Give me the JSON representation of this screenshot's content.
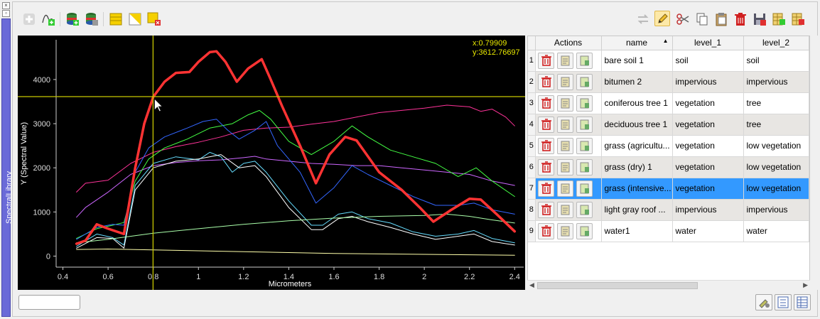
{
  "dock": {
    "title": "SpectralLibrary",
    "close_glyph": "×",
    "float_glyph": "▫"
  },
  "toolbar": {
    "left_tools": [
      "add-profile",
      "add-current-profile",
      "import-library",
      "export-library",
      "select-all",
      "invert-selection",
      "deselect"
    ],
    "right_tools": [
      "undo-redo",
      "toggle-editing",
      "cut",
      "copy",
      "paste",
      "delete-selected",
      "save-edits",
      "new-field",
      "delete-field"
    ],
    "editing_active": true
  },
  "plot": {
    "crosshair_x_label": "x:0.79909",
    "crosshair_y_label": "y:3612.76697",
    "crosshair": {
      "x": 0.79909,
      "y": 3612.76697
    },
    "xlabel": "Micrometers",
    "ylabel": "Y (Spectral Value)",
    "x_ticks": [
      "0.4",
      "0.6",
      "0.8",
      "1",
      "1.2",
      "1.4",
      "1.6",
      "1.8",
      "2",
      "2.2",
      "2.4"
    ],
    "y_ticks": [
      "0",
      "1000",
      "2000",
      "3000",
      "4000"
    ]
  },
  "chart_data": {
    "type": "line",
    "xlabel": "Micrometers",
    "ylabel": "Y (Spectral Value)",
    "xlim": [
      0.37,
      2.44
    ],
    "ylim": [
      -250,
      4900
    ],
    "grid": false,
    "series": [
      {
        "color": "#ff3333",
        "width": 3.5,
        "values": [
          [
            0.46,
            280
          ],
          [
            0.5,
            350
          ],
          [
            0.55,
            720
          ],
          [
            0.6,
            620
          ],
          [
            0.67,
            500
          ],
          [
            0.72,
            2000
          ],
          [
            0.76,
            3000
          ],
          [
            0.8,
            3610
          ],
          [
            0.85,
            3950
          ],
          [
            0.9,
            4150
          ],
          [
            0.96,
            4170
          ],
          [
            1.0,
            4400
          ],
          [
            1.05,
            4620
          ],
          [
            1.08,
            4640
          ],
          [
            1.12,
            4400
          ],
          [
            1.17,
            3950
          ],
          [
            1.22,
            4250
          ],
          [
            1.28,
            4460
          ],
          [
            1.32,
            4000
          ],
          [
            1.37,
            3400
          ],
          [
            1.45,
            2500
          ],
          [
            1.52,
            1650
          ],
          [
            1.58,
            2300
          ],
          [
            1.65,
            2700
          ],
          [
            1.7,
            2620
          ],
          [
            1.8,
            1900
          ],
          [
            1.9,
            1500
          ],
          [
            1.98,
            1100
          ],
          [
            2.04,
            780
          ],
          [
            2.12,
            1050
          ],
          [
            2.2,
            1300
          ],
          [
            2.25,
            1280
          ],
          [
            2.32,
            950
          ],
          [
            2.4,
            560
          ]
        ]
      },
      {
        "color": "#ff3399",
        "width": 1,
        "values": [
          [
            0.46,
            1450
          ],
          [
            0.5,
            1650
          ],
          [
            0.6,
            1720
          ],
          [
            0.7,
            2100
          ],
          [
            0.8,
            2350
          ],
          [
            0.9,
            2480
          ],
          [
            1.0,
            2580
          ],
          [
            1.1,
            2700
          ],
          [
            1.2,
            2850
          ],
          [
            1.3,
            2900
          ],
          [
            1.4,
            2920
          ],
          [
            1.5,
            2990
          ],
          [
            1.6,
            3050
          ],
          [
            1.7,
            3150
          ],
          [
            1.8,
            3250
          ],
          [
            1.9,
            3300
          ],
          [
            2.0,
            3350
          ],
          [
            2.1,
            3420
          ],
          [
            2.2,
            3380
          ],
          [
            2.25,
            3280
          ],
          [
            2.3,
            3330
          ],
          [
            2.36,
            3150
          ],
          [
            2.4,
            2950
          ]
        ]
      },
      {
        "color": "#cc66ff",
        "width": 1,
        "values": [
          [
            0.46,
            880
          ],
          [
            0.5,
            1100
          ],
          [
            0.6,
            1450
          ],
          [
            0.7,
            1850
          ],
          [
            0.8,
            2050
          ],
          [
            0.9,
            2120
          ],
          [
            1.0,
            2160
          ],
          [
            1.1,
            2180
          ],
          [
            1.2,
            2230
          ],
          [
            1.25,
            2260
          ],
          [
            1.3,
            2200
          ],
          [
            1.4,
            2150
          ],
          [
            1.5,
            2100
          ],
          [
            1.6,
            2080
          ],
          [
            1.7,
            2050
          ],
          [
            1.8,
            2050
          ],
          [
            1.9,
            2000
          ],
          [
            2.0,
            1950
          ],
          [
            2.1,
            1900
          ],
          [
            2.2,
            1850
          ],
          [
            2.3,
            1700
          ],
          [
            2.4,
            1600
          ]
        ]
      },
      {
        "color": "#44ff44",
        "width": 1,
        "values": [
          [
            0.46,
            400
          ],
          [
            0.55,
            620
          ],
          [
            0.62,
            700
          ],
          [
            0.67,
            760
          ],
          [
            0.72,
            1700
          ],
          [
            0.78,
            2200
          ],
          [
            0.85,
            2450
          ],
          [
            0.95,
            2650
          ],
          [
            1.05,
            2900
          ],
          [
            1.15,
            3000
          ],
          [
            1.22,
            3200
          ],
          [
            1.27,
            3300
          ],
          [
            1.32,
            3100
          ],
          [
            1.4,
            2600
          ],
          [
            1.5,
            2300
          ],
          [
            1.6,
            2600
          ],
          [
            1.68,
            2950
          ],
          [
            1.75,
            2700
          ],
          [
            1.85,
            2400
          ],
          [
            1.95,
            2250
          ],
          [
            2.05,
            2100
          ],
          [
            2.15,
            1800
          ],
          [
            2.23,
            2000
          ],
          [
            2.3,
            1700
          ],
          [
            2.4,
            1350
          ]
        ]
      },
      {
        "color": "#3366ff",
        "width": 1,
        "values": [
          [
            0.46,
            380
          ],
          [
            0.55,
            650
          ],
          [
            0.62,
            720
          ],
          [
            0.67,
            700
          ],
          [
            0.72,
            1900
          ],
          [
            0.78,
            2450
          ],
          [
            0.85,
            2700
          ],
          [
            0.95,
            2900
          ],
          [
            1.02,
            3050
          ],
          [
            1.08,
            3100
          ],
          [
            1.13,
            2850
          ],
          [
            1.18,
            2650
          ],
          [
            1.25,
            2850
          ],
          [
            1.3,
            3050
          ],
          [
            1.35,
            2500
          ],
          [
            1.45,
            1900
          ],
          [
            1.52,
            1200
          ],
          [
            1.6,
            1550
          ],
          [
            1.68,
            2050
          ],
          [
            1.75,
            1850
          ],
          [
            1.85,
            1600
          ],
          [
            1.95,
            1350
          ],
          [
            2.05,
            1150
          ],
          [
            2.15,
            1150
          ],
          [
            2.22,
            1200
          ],
          [
            2.3,
            1050
          ],
          [
            2.4,
            950
          ]
        ]
      },
      {
        "color": "#66ddff",
        "width": 1,
        "values": [
          [
            0.46,
            220
          ],
          [
            0.55,
            500
          ],
          [
            0.62,
            420
          ],
          [
            0.67,
            250
          ],
          [
            0.72,
            1600
          ],
          [
            0.8,
            2100
          ],
          [
            0.9,
            2250
          ],
          [
            1.0,
            2180
          ],
          [
            1.05,
            2350
          ],
          [
            1.1,
            2250
          ],
          [
            1.15,
            1900
          ],
          [
            1.2,
            2100
          ],
          [
            1.25,
            2150
          ],
          [
            1.3,
            1900
          ],
          [
            1.4,
            1250
          ],
          [
            1.5,
            700
          ],
          [
            1.55,
            700
          ],
          [
            1.62,
            950
          ],
          [
            1.68,
            1000
          ],
          [
            1.75,
            850
          ],
          [
            1.85,
            750
          ],
          [
            1.95,
            550
          ],
          [
            2.05,
            450
          ],
          [
            2.15,
            500
          ],
          [
            2.22,
            580
          ],
          [
            2.3,
            400
          ],
          [
            2.4,
            300
          ]
        ]
      },
      {
        "color": "#ffffff",
        "width": 1,
        "values": [
          [
            0.46,
            180
          ],
          [
            0.55,
            420
          ],
          [
            0.62,
            400
          ],
          [
            0.67,
            180
          ],
          [
            0.72,
            1500
          ],
          [
            0.8,
            2000
          ],
          [
            0.9,
            2150
          ],
          [
            1.0,
            2200
          ],
          [
            1.1,
            2300
          ],
          [
            1.18,
            2000
          ],
          [
            1.25,
            2050
          ],
          [
            1.3,
            1800
          ],
          [
            1.4,
            1100
          ],
          [
            1.5,
            600
          ],
          [
            1.55,
            600
          ],
          [
            1.62,
            850
          ],
          [
            1.68,
            900
          ],
          [
            1.75,
            780
          ],
          [
            1.85,
            650
          ],
          [
            1.95,
            500
          ],
          [
            2.05,
            380
          ],
          [
            2.15,
            450
          ],
          [
            2.22,
            500
          ],
          [
            2.3,
            330
          ],
          [
            2.4,
            250
          ]
        ]
      },
      {
        "color": "#aaffaa",
        "width": 1,
        "values": [
          [
            0.46,
            300
          ],
          [
            0.6,
            380
          ],
          [
            0.8,
            520
          ],
          [
            1.0,
            620
          ],
          [
            1.2,
            720
          ],
          [
            1.4,
            800
          ],
          [
            1.6,
            860
          ],
          [
            1.8,
            900
          ],
          [
            2.0,
            920
          ],
          [
            2.1,
            950
          ],
          [
            2.2,
            900
          ],
          [
            2.3,
            820
          ],
          [
            2.4,
            750
          ]
        ]
      },
      {
        "color": "#ffffaa",
        "width": 1,
        "values": [
          [
            0.46,
            150
          ],
          [
            0.6,
            160
          ],
          [
            0.8,
            140
          ],
          [
            1.0,
            120
          ],
          [
            1.2,
            100
          ],
          [
            1.4,
            80
          ],
          [
            1.6,
            60
          ],
          [
            1.8,
            50
          ],
          [
            2.0,
            40
          ],
          [
            2.2,
            30
          ],
          [
            2.4,
            20
          ]
        ]
      }
    ]
  },
  "table": {
    "columns": [
      "Actions",
      "name",
      "level_1",
      "level_2"
    ],
    "sort_indicator": "▲",
    "rows": [
      {
        "num": "1",
        "name": "bare soil 1",
        "level_1": "soil",
        "level_2": "soil"
      },
      {
        "num": "2",
        "name": "bitumen 2",
        "level_1": "impervious",
        "level_2": "impervious"
      },
      {
        "num": "3",
        "name": "coniferous tree 1",
        "level_1": "vegetation",
        "level_2": "tree"
      },
      {
        "num": "4",
        "name": "deciduous tree 1",
        "level_1": "vegetation",
        "level_2": "tree"
      },
      {
        "num": "5",
        "name": "grass (agricultu...",
        "level_1": "vegetation",
        "level_2": "low vegetation"
      },
      {
        "num": "6",
        "name": "grass (dry) 1",
        "level_1": "vegetation",
        "level_2": "low vegetation"
      },
      {
        "num": "7",
        "name": "grass (intensive...",
        "level_1": "vegetation",
        "level_2": "low vegetation"
      },
      {
        "num": "8",
        "name": "light gray roof ...",
        "level_1": "impervious",
        "level_2": "impervious"
      },
      {
        "num": "9",
        "name": "water1",
        "level_1": "water",
        "level_2": "water"
      }
    ],
    "selected_row": 7
  },
  "footer": {
    "filter_value": ""
  },
  "colors": {
    "dock_bar": "#6a6ad8",
    "selection": "#3399ff",
    "crosshair": "#c8c800",
    "plot_bg": "#000000"
  }
}
